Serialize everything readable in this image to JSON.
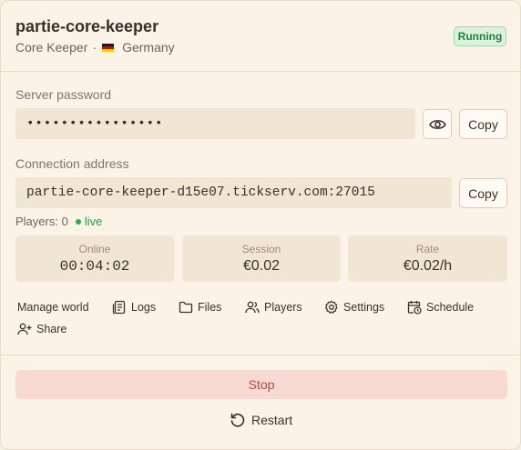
{
  "server": {
    "name": "partie-core-keeper",
    "game": "Core Keeper",
    "separator": "·",
    "region": "Germany",
    "status": "Running"
  },
  "password": {
    "label": "Server password",
    "value": "••••••••••••••••",
    "copy_label": "Copy"
  },
  "connection": {
    "label": "Connection address",
    "value": "partie-core-keeper-d15e07.tickserv.com:27015",
    "copy_label": "Copy"
  },
  "players": {
    "text": "Players: 0",
    "live_text": "live"
  },
  "stats": [
    {
      "label": "Online",
      "value": "00:04:02"
    },
    {
      "label": "Session",
      "value": "€0.02"
    },
    {
      "label": "Rate",
      "value": "€0.02/h"
    }
  ],
  "actions": {
    "manage_world": "Manage world",
    "logs": "Logs",
    "files": "Files",
    "players": "Players",
    "settings": "Settings",
    "schedule": "Schedule",
    "share": "Share"
  },
  "controls": {
    "stop": "Stop",
    "restart": "Restart"
  },
  "colors": {
    "background": "#fbf3e8",
    "status_green": "#25823b",
    "stop_bg": "#f8d9d3",
    "stop_text": "#c0483c"
  }
}
